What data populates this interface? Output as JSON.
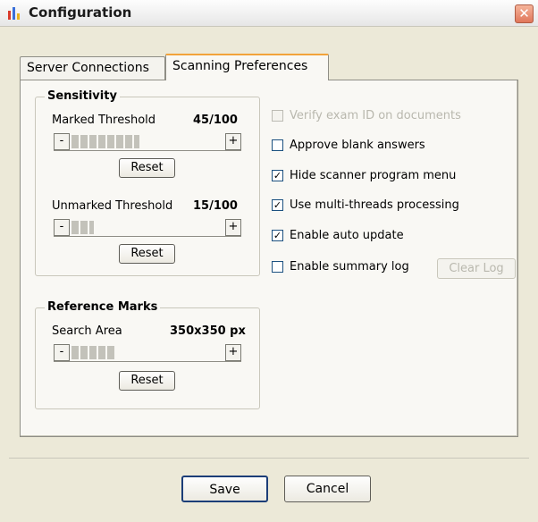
{
  "window": {
    "title": "Configuration",
    "close_label": "✕"
  },
  "tabs": [
    {
      "label": "Server Connections",
      "active": false
    },
    {
      "label": "Scanning Preferences",
      "active": true
    }
  ],
  "sensitivity": {
    "title": "Sensitivity",
    "marked": {
      "label": "Marked Threshold",
      "value": "45/100",
      "level": 0.45
    },
    "unmarked": {
      "label": "Unmarked Threshold",
      "value": "15/100",
      "level": 0.15
    },
    "reset_label": "Reset",
    "minus": "-",
    "plus": "+"
  },
  "reference_marks": {
    "title": "Reference Marks",
    "search_area": {
      "label": "Search Area",
      "value": "350x350 px",
      "level": 0.3
    },
    "reset_label": "Reset"
  },
  "options": [
    {
      "label": "Verify exam ID on documents",
      "checked": false,
      "enabled": false
    },
    {
      "label": "Approve blank answers",
      "checked": false,
      "enabled": true
    },
    {
      "label": "Hide scanner program menu",
      "checked": true,
      "enabled": true
    },
    {
      "label": "Use multi-threads processing",
      "checked": true,
      "enabled": true
    },
    {
      "label": "Enable auto update",
      "checked": true,
      "enabled": true
    },
    {
      "label": "Enable summary log",
      "checked": false,
      "enabled": true
    }
  ],
  "clear_log_label": "Clear Log",
  "footer": {
    "save_label": "Save",
    "cancel_label": "Cancel"
  },
  "colors": {
    "accent_tab": "#f2a33a",
    "close_button": "#e0765a",
    "window_bg": "#ece9d8"
  }
}
